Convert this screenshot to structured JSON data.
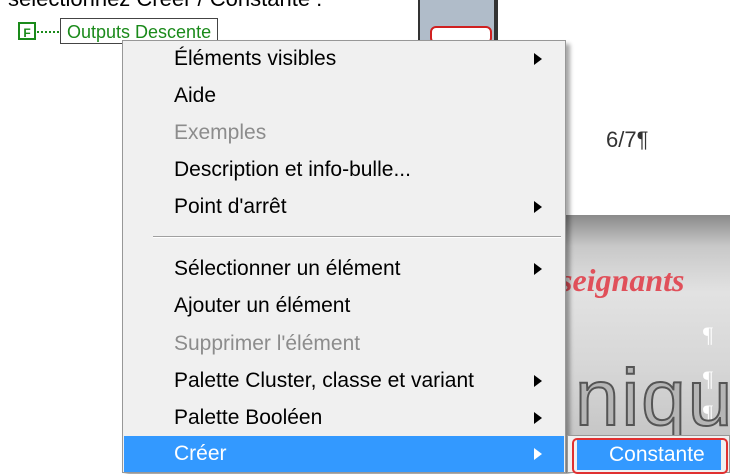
{
  "document": {
    "top_text": "sélectionnez Créer / Constante :",
    "page_number": "6/7¶",
    "slide_text": "seignants",
    "slide_pilcrow": "¶",
    "slide_big_text": "niqu"
  },
  "diagram": {
    "terminal_letter": "F",
    "node_label": "Outputs Descente"
  },
  "context_menu": {
    "items": [
      {
        "label": "Éléments visibles",
        "disabled": false,
        "submenu": true
      },
      {
        "label": "Aide",
        "disabled": false,
        "submenu": false
      },
      {
        "label": "Exemples",
        "disabled": true,
        "submenu": false
      },
      {
        "label": "Description et info-bulle...",
        "disabled": false,
        "submenu": false
      },
      {
        "label": "Point d'arrêt",
        "disabled": false,
        "submenu": true
      },
      {
        "label": "Sélectionner un élément",
        "disabled": false,
        "submenu": true
      },
      {
        "label": "Ajouter un élément",
        "disabled": false,
        "submenu": false
      },
      {
        "label": "Supprimer l'élément",
        "disabled": true,
        "submenu": false
      },
      {
        "label": "Palette Cluster, classe et variant",
        "disabled": false,
        "submenu": true
      },
      {
        "label": "Palette Booléen",
        "disabled": false,
        "submenu": true
      },
      {
        "label": "Créer",
        "disabled": false,
        "submenu": true,
        "highlighted": true
      }
    ]
  },
  "submenu": {
    "selected_label": "Constante"
  },
  "colors": {
    "highlight": "#3399ff",
    "labview_green": "#1a8a1a",
    "annotation_red": "#e03030"
  }
}
